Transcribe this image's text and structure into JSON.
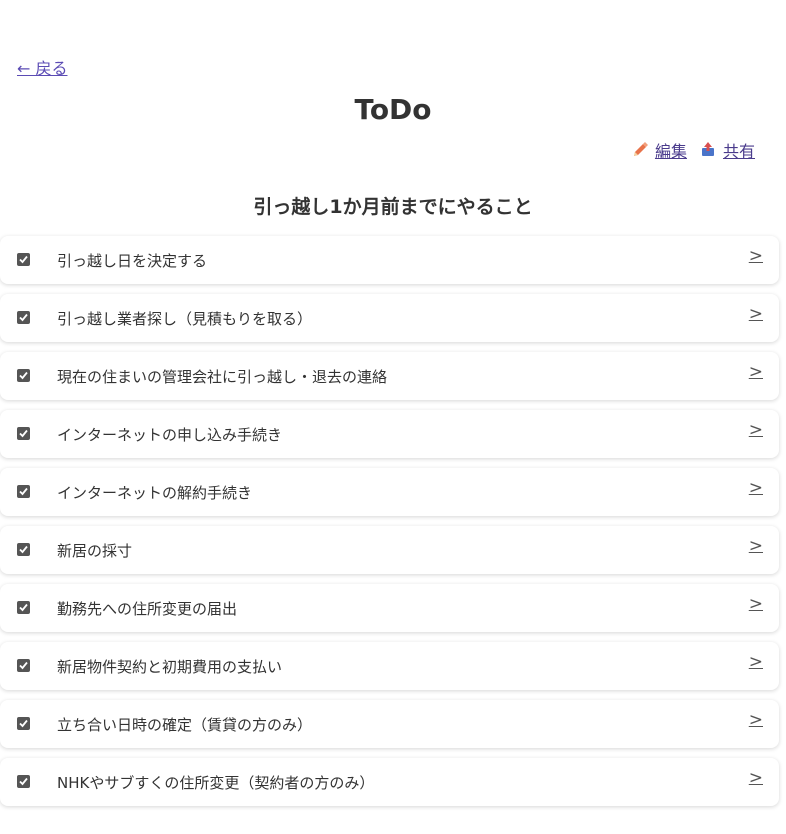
{
  "nav": {
    "back_label": "← 戻る"
  },
  "header": {
    "title": "ToDo"
  },
  "actions": {
    "edit_label": "編集",
    "share_label": "共有"
  },
  "section": {
    "title": "引っ越し1か月前までにやること"
  },
  "todos": [
    {
      "label": "引っ越し日を決定する",
      "checked": true
    },
    {
      "label": "引っ越し業者探し（見積もりを取る）",
      "checked": true
    },
    {
      "label": "現在の住まいの管理会社に引っ越し・退去の連絡",
      "checked": true
    },
    {
      "label": "インターネットの申し込み手続き",
      "checked": true
    },
    {
      "label": "インターネットの解約手続き",
      "checked": true
    },
    {
      "label": "新居の採寸",
      "checked": true
    },
    {
      "label": "勤務先への住所変更の届出",
      "checked": true
    },
    {
      "label": "新居物件契約と初期費用の支払い",
      "checked": true
    },
    {
      "label": "立ち合い日時の確定（賃貸の方のみ）",
      "checked": true
    },
    {
      "label": "NHKやサブすくの住所変更（契約者の方のみ）",
      "checked": true
    }
  ],
  "chevron_symbol": ">",
  "colors": {
    "link": "#5b4bb4",
    "pencil": "#e8734a",
    "share": "#d94f4f"
  }
}
